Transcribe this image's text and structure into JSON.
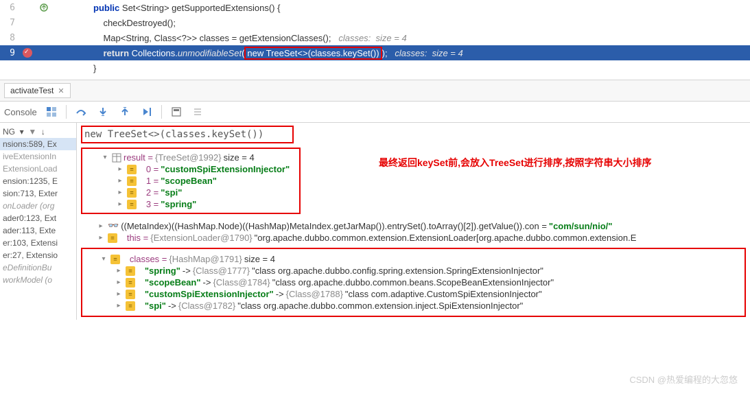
{
  "editor": {
    "lines": {
      "l6": "6",
      "l7": "7",
      "l8": "8",
      "l9": "9",
      "sig_pre": "public Set<String> ",
      "sig_name": "getSupportedExtensions",
      "sig_post": "() {",
      "check": "checkDestroyed();",
      "map_decl": "Map<String, Class<?>> classes = getExtensionClasses();",
      "map_comment": "classes:  size = 4",
      "ret_pre": "return Collections.",
      "ret_fn": "unmodifiableSet",
      "ret_open": "(",
      "ret_boxed": "new TreeSet<>(classes.keySet())",
      "ret_close": ");",
      "ret_comment": "classes:  size = 4",
      "brace": "}"
    }
  },
  "tab": {
    "name": "activateTest"
  },
  "toolbar": {
    "console": "Console"
  },
  "eval": {
    "expr": "new TreeSet<>(classes.keySet())"
  },
  "annotation": "最终返回keySet前,会放入TreeSet进行排序,按照字符串大小排序",
  "threads": {
    "ng": "NG",
    "t1": "nsions:589, Ex",
    "t2": "iveExtensionIn",
    "t3": "ExtensionLoad",
    "t4": "ension:1235, E",
    "t5": "sion:713, Exter",
    "t6": "onLoader (org",
    "t7": "ader0:123, Ext",
    "t8": "ader:113, Exte",
    "t9": "er:103, Extensi",
    "t10": "er:27, Extensio",
    "t11": "eDefinitionBu",
    "t12": "workModel (o"
  },
  "vars": {
    "result_label": "result = ",
    "result_ref": "{TreeSet@1992}",
    "result_size": "  size = 4",
    "i0": "0 = ",
    "v0": "\"customSpiExtensionInjector\"",
    "i1": "1 = ",
    "v1": "\"scopeBean\"",
    "i2": "2 = ",
    "v2": "\"spi\"",
    "i3": "3 = ",
    "v3": "\"spring\"",
    "meta": "((MetaIndex)((HashMap.Node)((HashMap)MetaIndex.getJarMap()).entrySet().toArray()[2]).getValue()).con = ",
    "meta_v": "\"com/sun/nio/\"",
    "this_label": "this = ",
    "this_ref": "{ExtensionLoader@1790}",
    "this_str": " \"org.apache.dubbo.common.extension.ExtensionLoader[org.apache.dubbo.common.extension.E",
    "classes_label": "classes = ",
    "classes_ref": "{HashMap@1791}",
    "classes_size": "  size = 4",
    "c0k": "\"spring\"",
    "c0a": " -> ",
    "c0r": "{Class@1777}",
    "c0v": " \"class org.apache.dubbo.config.spring.extension.SpringExtensionInjector\"",
    "c1k": "\"scopeBean\"",
    "c1a": " -> ",
    "c1r": "{Class@1784}",
    "c1v": " \"class org.apache.dubbo.common.beans.ScopeBeanExtensionInjector\"",
    "c2k": "\"customSpiExtensionInjector\"",
    "c2a": " -> ",
    "c2r": "{Class@1788}",
    "c2v": " \"class com.adaptive.CustomSpiExtensionInjector\"",
    "c3k": "\"spi\"",
    "c3a": " -> ",
    "c3r": "{Class@1782}",
    "c3v": " \"class org.apache.dubbo.common.extension.inject.SpiExtensionInjector\""
  },
  "watermark": "CSDN @热爱编程的大忽悠"
}
